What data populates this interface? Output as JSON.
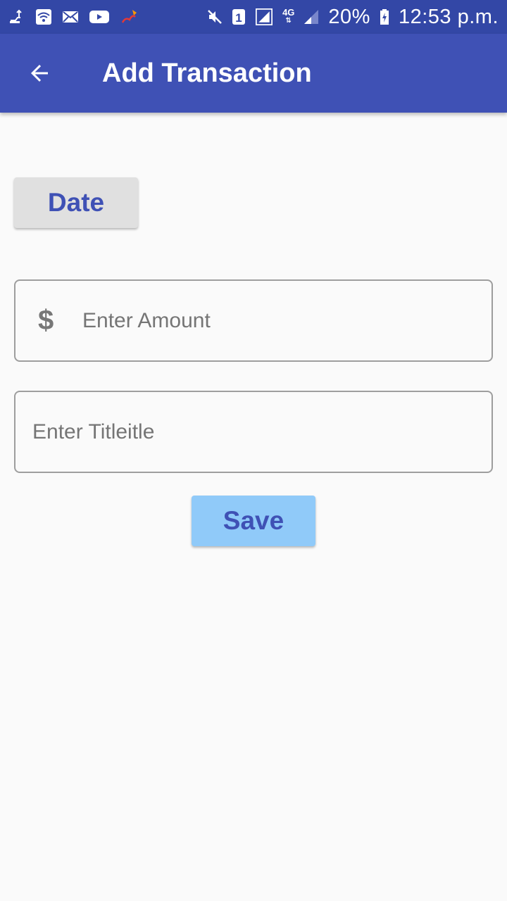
{
  "status_bar": {
    "battery": "20%",
    "time": "12:53 p.m.",
    "network": "4G",
    "sim_slot": "1",
    "left_icons": [
      "usb-icon",
      "wifi-icon",
      "mail-icon",
      "youtube-icon",
      "app-notification-icon"
    ],
    "right_icons": [
      "mute-icon",
      "sim-1-icon",
      "signal-icon",
      "network-4g-icon",
      "signal-weak-icon",
      "battery-charging-icon"
    ]
  },
  "app_bar": {
    "title": "Add Transaction",
    "color": "#3f51b5",
    "back_icon": "arrow-back-icon"
  },
  "form": {
    "date_button_label": "Date",
    "amount": {
      "icon": "dollar-icon",
      "icon_glyph": "$",
      "placeholder": "Enter Amount",
      "value": ""
    },
    "title": {
      "placeholder": "Enter Titleitle",
      "value": ""
    },
    "save_button_label": "Save",
    "save_button_color": "#90caf9",
    "accent_color": "#3f51b5"
  }
}
